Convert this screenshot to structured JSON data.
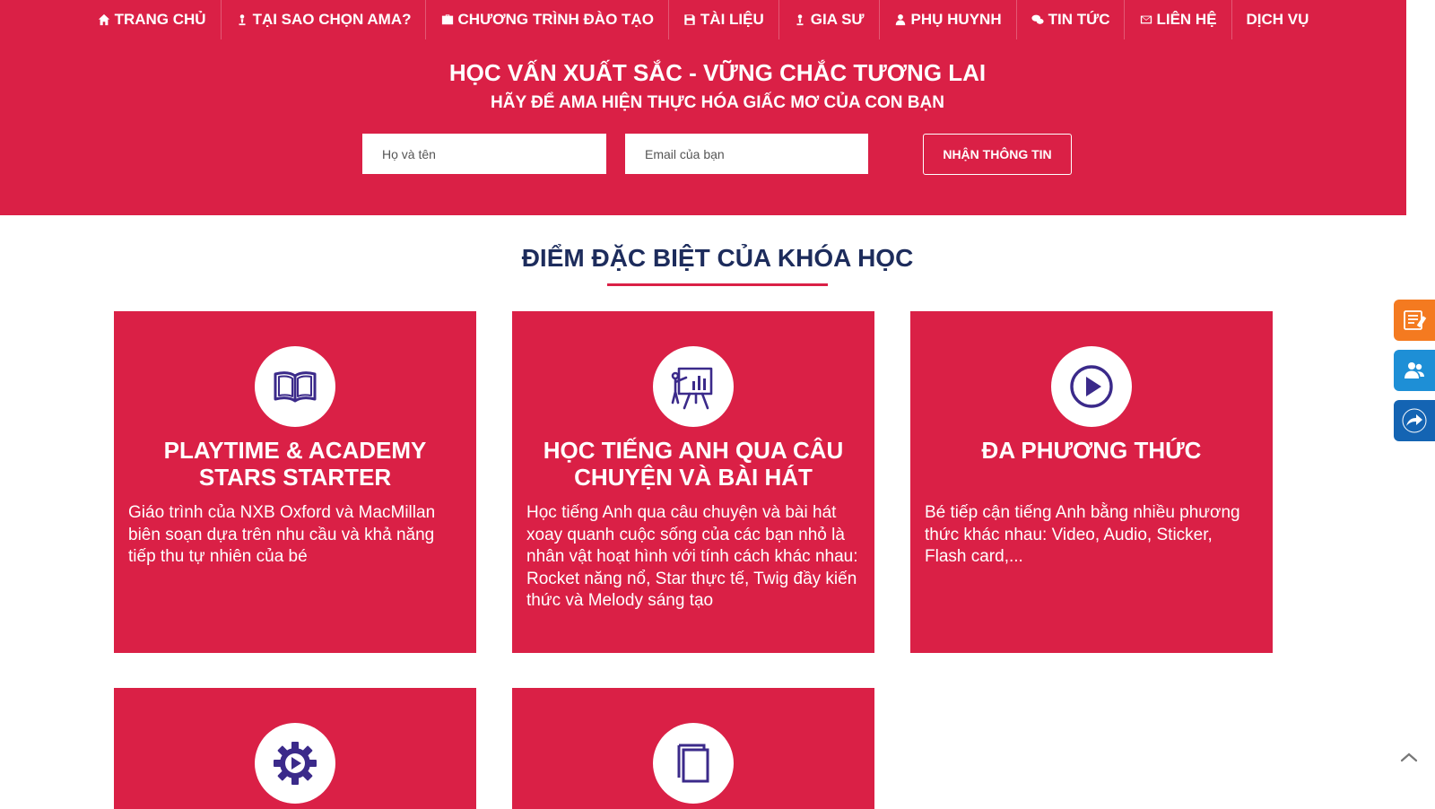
{
  "nav": {
    "items": [
      {
        "label": "TRANG CHỦ",
        "icon": "home-icon"
      },
      {
        "label": "TẠI SAO CHỌN AMA?",
        "icon": "user-icon"
      },
      {
        "label": "CHƯƠNG TRÌNH ĐÀO TẠO",
        "icon": "briefcase-icon"
      },
      {
        "label": "TÀI LIỆU",
        "icon": "save-icon"
      },
      {
        "label": "GIA SƯ",
        "icon": "user-icon"
      },
      {
        "label": "PHỤ HUYNH",
        "icon": "user-icon"
      },
      {
        "label": "TIN TỨC",
        "icon": "chat-icon"
      },
      {
        "label": "LIÊN HỆ",
        "icon": "envelope-icon"
      },
      {
        "label": "DỊCH VỤ",
        "icon": ""
      }
    ]
  },
  "hero": {
    "title": "HỌC VẤN XUẤT SẮC - VỮNG CHẮC TƯƠNG LAI",
    "subtitle": "HÃY ĐỂ AMA HIỆN THỰC HÓA GIẤC MƠ CỦA CON BẠN",
    "name_placeholder": "Họ và tên",
    "email_placeholder": "Email của bạn",
    "submit_label": "NHẬN THÔNG TIN"
  },
  "section": {
    "title": "ĐIỂM ĐẶC BIỆT CỦA KHÓA HỌC"
  },
  "cards": [
    {
      "icon": "open-book-icon",
      "title": "PLAYTIME & ACADEMY STARS STARTER",
      "text": "Giáo trình của NXB Oxford và MacMillan biên soạn dựa trên nhu cầu và khả năng tiếp thu tự nhiên của bé"
    },
    {
      "icon": "presentation-board-icon",
      "title": "HỌC TIẾNG ANH QUA CÂU CHUYỆN VÀ BÀI HÁT",
      "text": "Học tiếng Anh qua câu chuyện và bài hát xoay quanh cuộc sống của các bạn nhỏ là nhân vật hoạt hình với tính cách khác nhau: Rocket năng nổ, Star thực tế, Twig đầy kiến thức và Melody sáng tạo"
    },
    {
      "icon": "play-circle-icon",
      "title": "ĐA PHƯƠNG THỨC",
      "text": "Bé tiếp cận tiếng Anh bằng nhiều phương thức khác nhau: Video, Audio, Sticker, Flash card,..."
    },
    {
      "icon": "gear-play-icon",
      "title": "",
      "text": ""
    },
    {
      "icon": "copy-pages-icon",
      "title": "",
      "text": ""
    }
  ],
  "floating": {
    "register_icon": "register-form-icon",
    "consult_icon": "people-icon",
    "share_icon": "share-arrow-icon",
    "scroll_icon": "chevron-up-icon"
  },
  "colors": {
    "brand_red": "#da2046",
    "heading_navy": "#1d2c5c",
    "icon_purple": "#3b2a8a",
    "float_orange": "#f47a20",
    "float_blue": "#1e8fd6",
    "float_dark_blue": "#1464b3"
  }
}
